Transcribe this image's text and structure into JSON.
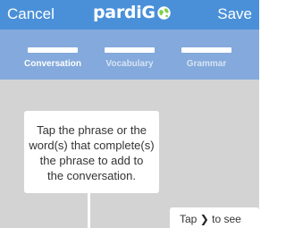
{
  "navbar": {
    "cancel_label": "Cancel",
    "save_label": "Save",
    "logo_text": "pardiG"
  },
  "tabs": [
    {
      "label": "Conversation",
      "selected": true
    },
    {
      "label": "Vocabulary",
      "selected": false
    },
    {
      "label": "Grammar",
      "selected": false
    }
  ],
  "tutorial": {
    "main_lines": [
      "Tap the phrase or the",
      "word(s) that complete(s)",
      "the phrase to add to",
      "the conversation."
    ],
    "side_prefix": "Tap",
    "side_suffix": "to see"
  },
  "colors": {
    "navbar": "#4a90d9",
    "tabs": "#84a9dc",
    "background": "#d3d3d3",
    "callout": "#ffffff"
  }
}
